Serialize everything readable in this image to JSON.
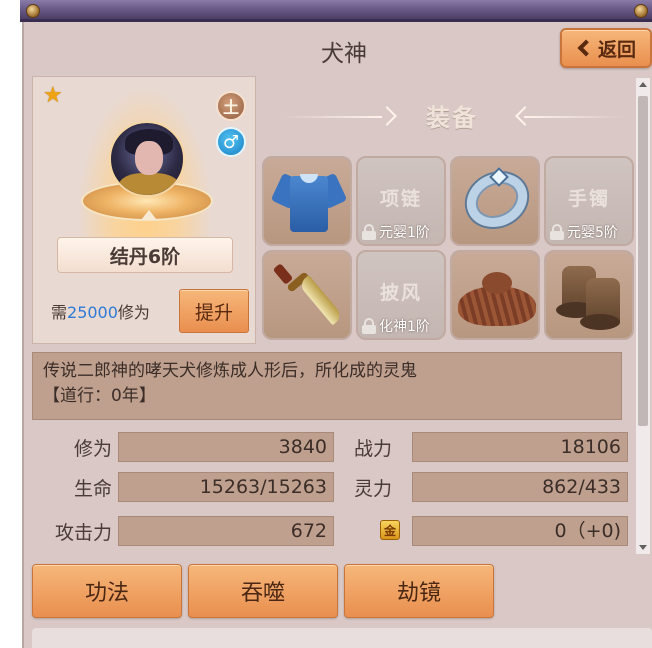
{
  "window": {
    "title": "犬神",
    "back_label": "返回"
  },
  "character": {
    "realm": "结丹6阶",
    "upgrade_prefix": "需",
    "upgrade_cost": "25000",
    "upgrade_suffix": "修为",
    "upgrade_button": "提升",
    "rank_glyph": "土",
    "gender_glyph": "♂"
  },
  "equipment": {
    "title": "装备",
    "slots": [
      {
        "name": "shirt",
        "locked": false,
        "placeholder": "",
        "lock_text": ""
      },
      {
        "name": "necklace",
        "locked": true,
        "placeholder": "项链",
        "lock_text": "元婴1阶"
      },
      {
        "name": "ring",
        "locked": false,
        "placeholder": "",
        "lock_text": ""
      },
      {
        "name": "bracelet",
        "locked": true,
        "placeholder": "手镯",
        "lock_text": "元婴5阶"
      },
      {
        "name": "weapon",
        "locked": false,
        "placeholder": "",
        "lock_text": ""
      },
      {
        "name": "cloak",
        "locked": true,
        "placeholder": "披风",
        "lock_text": "化神1阶"
      },
      {
        "name": "hat",
        "locked": false,
        "placeholder": "",
        "lock_text": ""
      },
      {
        "name": "boots",
        "locked": false,
        "placeholder": "",
        "lock_text": ""
      }
    ]
  },
  "description": {
    "line1": "传说二郎神的哮天犬修炼成人形后，所化成的灵鬼",
    "line2": "【道行：0年】"
  },
  "stats": {
    "cultivation_label": "修为",
    "cultivation_value": "3840",
    "power_label": "战力",
    "power_value": "18106",
    "hp_label": "生命",
    "hp_value": "15263/15263",
    "spirit_label": "灵力",
    "spirit_value": "862/433",
    "attack_label": "攻击力",
    "attack_value": "672",
    "gold_glyph": "金",
    "gold_value": "0（+0)"
  },
  "actions": {
    "technique": "功法",
    "devour": "吞噬",
    "tribulation": "劫镜"
  }
}
